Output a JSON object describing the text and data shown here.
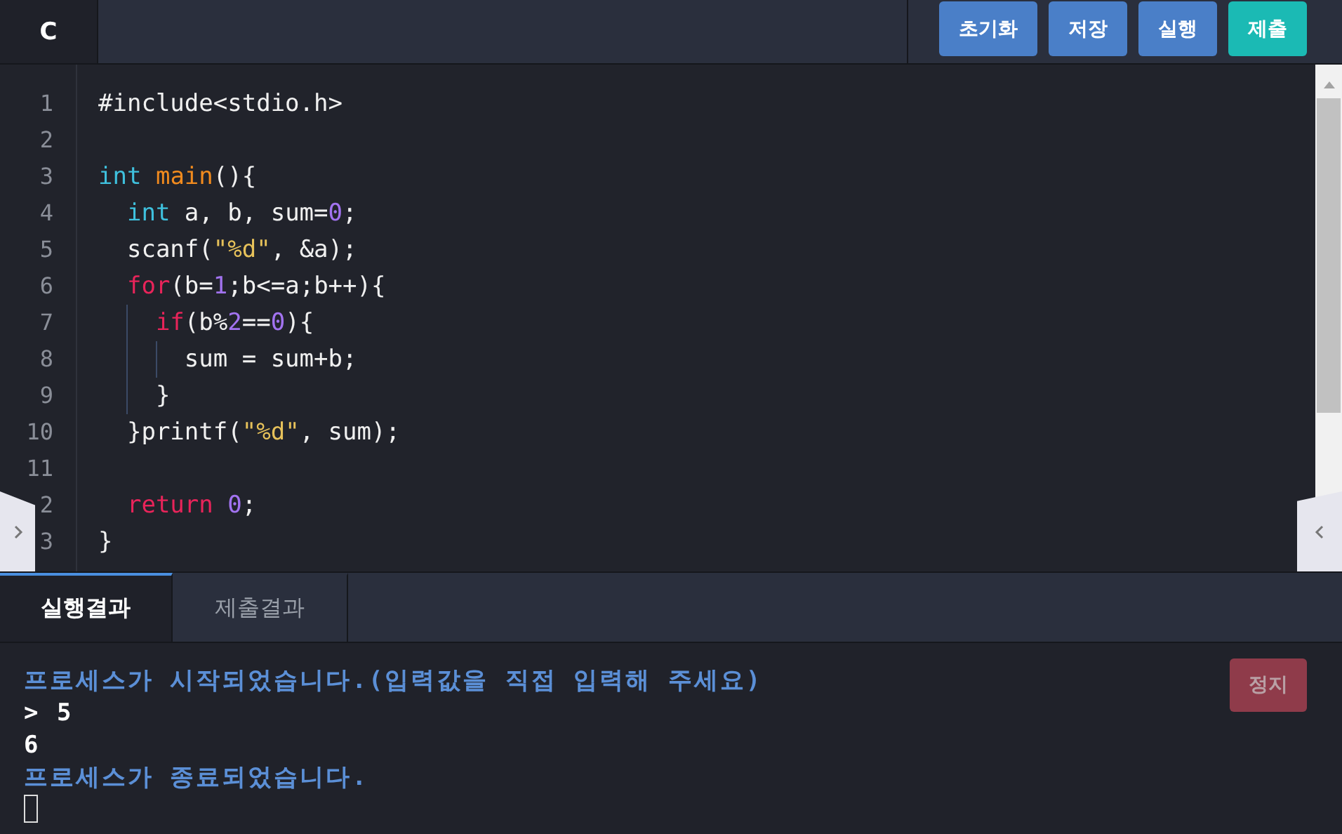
{
  "language_tab": {
    "label": "C",
    "selected": true
  },
  "toolbar_buttons": [
    {
      "label": "초기화",
      "kind": "primary"
    },
    {
      "label": "저장",
      "kind": "primary"
    },
    {
      "label": "실행",
      "kind": "primary"
    },
    {
      "label": "제출",
      "kind": "accent"
    }
  ],
  "code_lines": [
    {
      "number": "1",
      "tokens": [
        {
          "text": "#include<stdio.h>",
          "kind": "plain"
        }
      ]
    },
    {
      "number": "2"
    },
    {
      "number": "3",
      "tokens": [
        {
          "text": "int",
          "kind": "type"
        },
        {
          "text": " main",
          "kind": "function"
        },
        {
          "text": "(){",
          "kind": "plain"
        }
      ]
    },
    {
      "number": "4",
      "tokens": [
        {
          "text": "  int",
          "kind": "type"
        },
        {
          "text": " a, b, sum=",
          "kind": "plain"
        },
        {
          "text": "0",
          "kind": "number"
        },
        {
          "text": ";",
          "kind": "plain"
        }
      ]
    },
    {
      "number": "5",
      "tokens": [
        {
          "text": "  scanf(",
          "kind": "plain"
        },
        {
          "text": "\"%d\"",
          "kind": "string"
        },
        {
          "text": ", &a);",
          "kind": "plain"
        }
      ]
    },
    {
      "number": "6",
      "tokens": [
        {
          "text": "  for",
          "kind": "keyword"
        },
        {
          "text": "(b=",
          "kind": "plain"
        },
        {
          "text": "1",
          "kind": "number"
        },
        {
          "text": ";b<=a;b++){",
          "kind": "plain"
        }
      ]
    },
    {
      "number": "7",
      "tokens": [
        {
          "text": "    if",
          "kind": "keyword"
        },
        {
          "text": "(b%",
          "kind": "plain"
        },
        {
          "text": "2",
          "kind": "number"
        },
        {
          "text": "==",
          "kind": "plain"
        },
        {
          "text": "0",
          "kind": "number"
        },
        {
          "text": "){",
          "kind": "plain"
        }
      ]
    },
    {
      "number": "8",
      "tokens": [
        {
          "text": "      sum = sum+b;",
          "kind": "plain"
        }
      ]
    },
    {
      "number": "9",
      "tokens": [
        {
          "text": "    }",
          "kind": "plain"
        }
      ]
    },
    {
      "number": "10",
      "tokens": [
        {
          "text": "  }printf(",
          "kind": "plain"
        },
        {
          "text": "\"%d\"",
          "kind": "string"
        },
        {
          "text": ", sum);",
          "kind": "plain"
        }
      ]
    },
    {
      "number": "11"
    },
    {
      "number": "2",
      "tokens": [
        {
          "text": "  return",
          "kind": "keyword"
        },
        {
          "text": " 0",
          "kind": "number"
        },
        {
          "text": ";",
          "kind": "plain"
        }
      ]
    },
    {
      "number": "3",
      "tokens": [
        {
          "text": "}",
          "kind": "plain"
        }
      ]
    }
  ],
  "result_tabs": [
    {
      "label": "실행결과",
      "selected": true
    },
    {
      "label": "제출결과",
      "selected": false
    }
  ],
  "stop_button": {
    "label": "정지",
    "disabled": true
  },
  "console_lines": [
    {
      "text": "프로세스가 시작되었습니다.(입력값을 직접 입력해 주세요)",
      "kind": "system"
    },
    {
      "text": "> 5",
      "kind": "output"
    },
    {
      "text": "6",
      "kind": "output"
    },
    {
      "text": "프로세스가 종료되었습니다.",
      "kind": "system"
    }
  ]
}
